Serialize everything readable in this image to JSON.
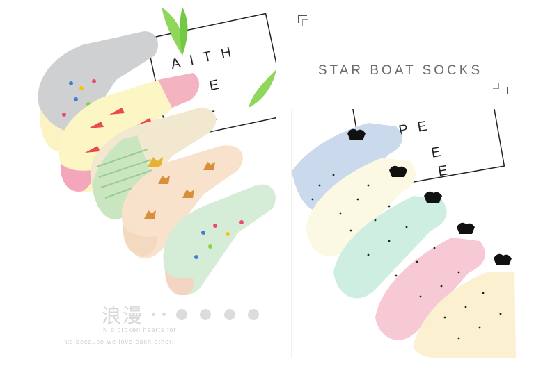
{
  "brand": {
    "title": "STAR BOAT SOCKS"
  },
  "left_photo": {
    "card_text": [
      "AITH",
      "PE",
      "E"
    ]
  },
  "right_photo": {
    "card_text": [
      "OPE",
      "E",
      "E"
    ]
  },
  "watermark": {
    "characters": "浪漫",
    "line1": "N o  broken  hearts for",
    "line2": "us because we love each other."
  },
  "colors": {
    "title_text": "#6c6c6c",
    "watermark": "#d7d7d7"
  }
}
